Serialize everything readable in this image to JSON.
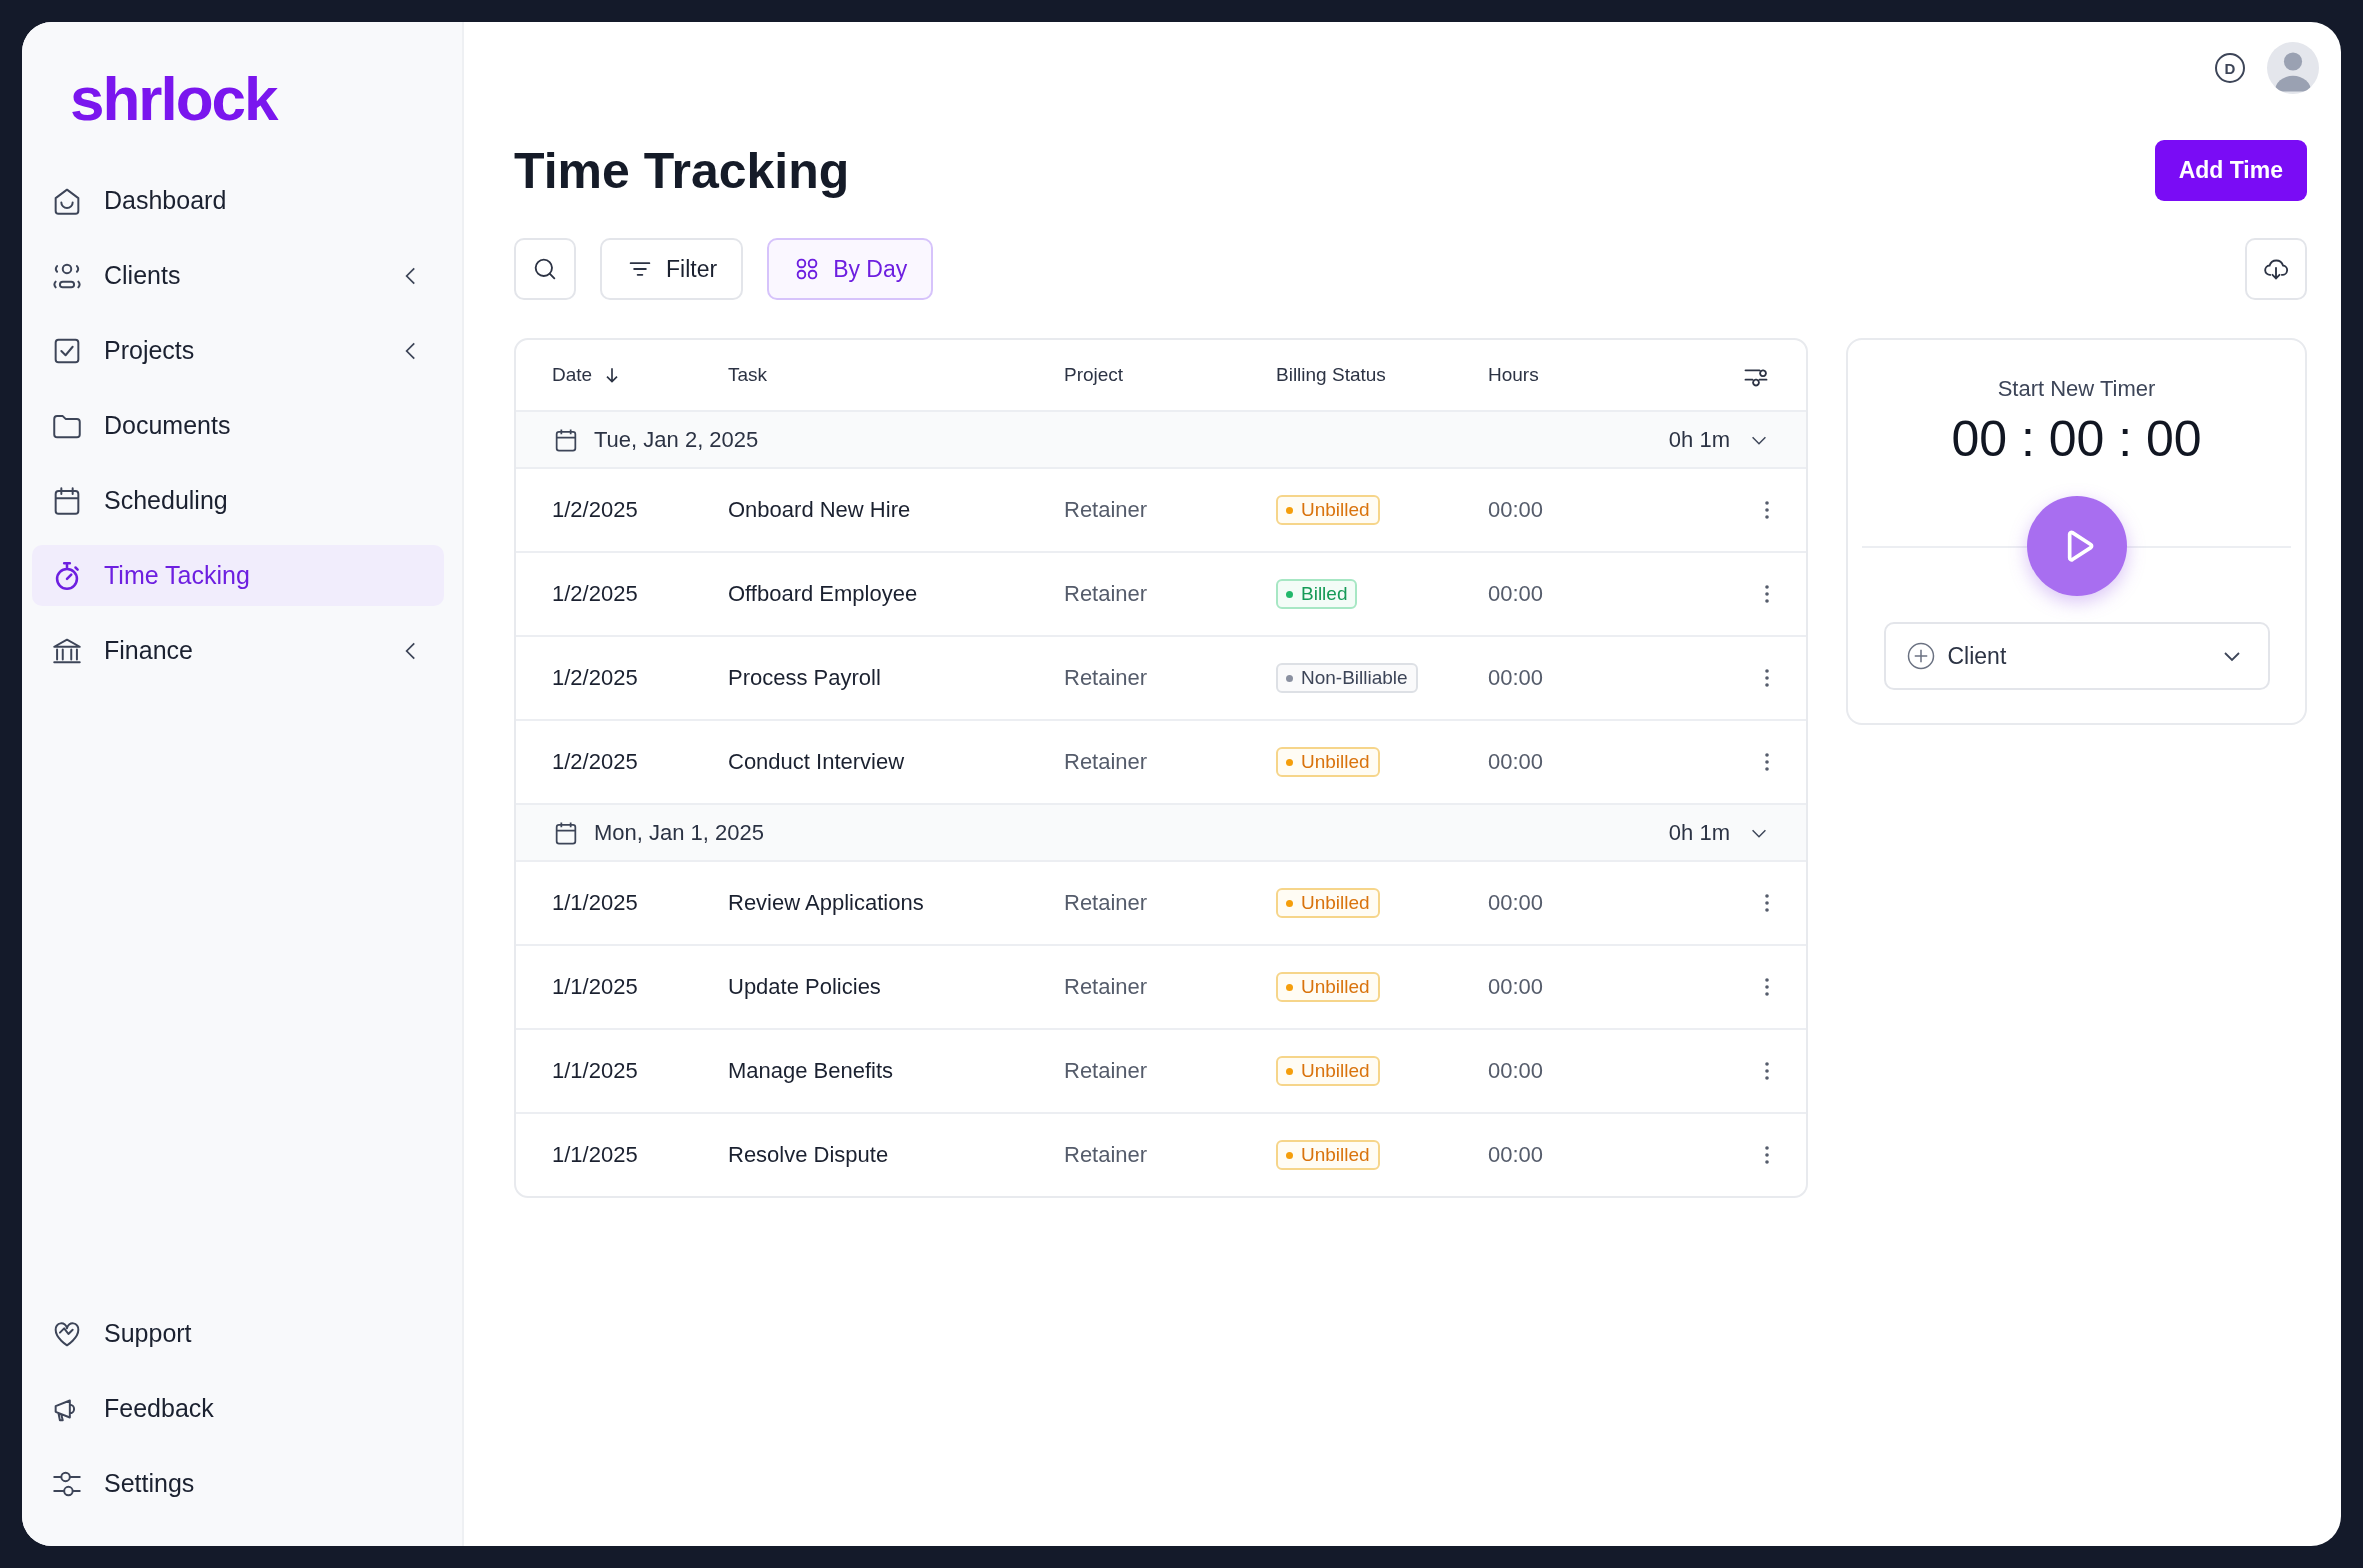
{
  "logo": "shrlock",
  "sidebar": {
    "items": [
      {
        "label": "Dashboard",
        "selected": false,
        "expandable": false
      },
      {
        "label": "Clients",
        "selected": false,
        "expandable": true
      },
      {
        "label": "Projects",
        "selected": false,
        "expandable": true
      },
      {
        "label": "Documents",
        "selected": false,
        "expandable": false
      },
      {
        "label": "Scheduling",
        "selected": false,
        "expandable": false
      },
      {
        "label": "Time Tacking",
        "selected": true,
        "expandable": false
      },
      {
        "label": "Finance",
        "selected": false,
        "expandable": true
      }
    ],
    "bottom_items": [
      {
        "label": "Support"
      },
      {
        "label": "Feedback"
      },
      {
        "label": "Settings"
      }
    ]
  },
  "top_bar": {
    "badge_letter": "D"
  },
  "page": {
    "title": "Time Tracking",
    "add_button": "Add Time"
  },
  "toolbar": {
    "filter": "Filter",
    "view_toggle": {
      "label": "By Day",
      "selected": true
    }
  },
  "table": {
    "columns": [
      "Date",
      "Task",
      "Project",
      "Billing Status",
      "Hours"
    ],
    "groups": [
      {
        "date": "Tue, Jan 2, 2025",
        "total": "0h 1m",
        "expanded": true,
        "rows": [
          {
            "date": "1/2/2025",
            "task": "Onboard New Hire",
            "project": "Retainer",
            "billing": {
              "label": "Unbilled",
              "kind": "unbilled"
            },
            "hours": "00:00"
          },
          {
            "date": "1/2/2025",
            "task": "Offboard Employee",
            "project": "Retainer",
            "billing": {
              "label": "Billed",
              "kind": "billed"
            },
            "hours": "00:00"
          },
          {
            "date": "1/2/2025",
            "task": "Process Payroll",
            "project": "Retainer",
            "billing": {
              "label": "Non-Billiable",
              "kind": "non_billable"
            },
            "hours": "00:00"
          },
          {
            "date": "1/2/2025",
            "task": "Conduct Interview",
            "project": "Retainer",
            "billing": {
              "label": "Unbilled",
              "kind": "unbilled"
            },
            "hours": "00:00"
          }
        ]
      },
      {
        "date": "Mon, Jan 1, 2025",
        "total": "0h 1m",
        "expanded": true,
        "rows": [
          {
            "date": "1/1/2025",
            "task": "Review Applications",
            "project": "Retainer",
            "billing": {
              "label": "Unbilled",
              "kind": "unbilled"
            },
            "hours": "00:00"
          },
          {
            "date": "1/1/2025",
            "task": "Update Policies",
            "project": "Retainer",
            "billing": {
              "label": "Unbilled",
              "kind": "unbilled"
            },
            "hours": "00:00"
          },
          {
            "date": "1/1/2025",
            "task": "Manage Benefits",
            "project": "Retainer",
            "billing": {
              "label": "Unbilled",
              "kind": "unbilled"
            },
            "hours": "00:00"
          },
          {
            "date": "1/1/2025",
            "task": "Resolve Dispute",
            "project": "Retainer",
            "billing": {
              "label": "Unbilled",
              "kind": "unbilled"
            },
            "hours": "00:00"
          }
        ]
      }
    ]
  },
  "timer": {
    "title": "Start New Timer",
    "time": "00 : 00 : 00",
    "client_select": "Client"
  }
}
